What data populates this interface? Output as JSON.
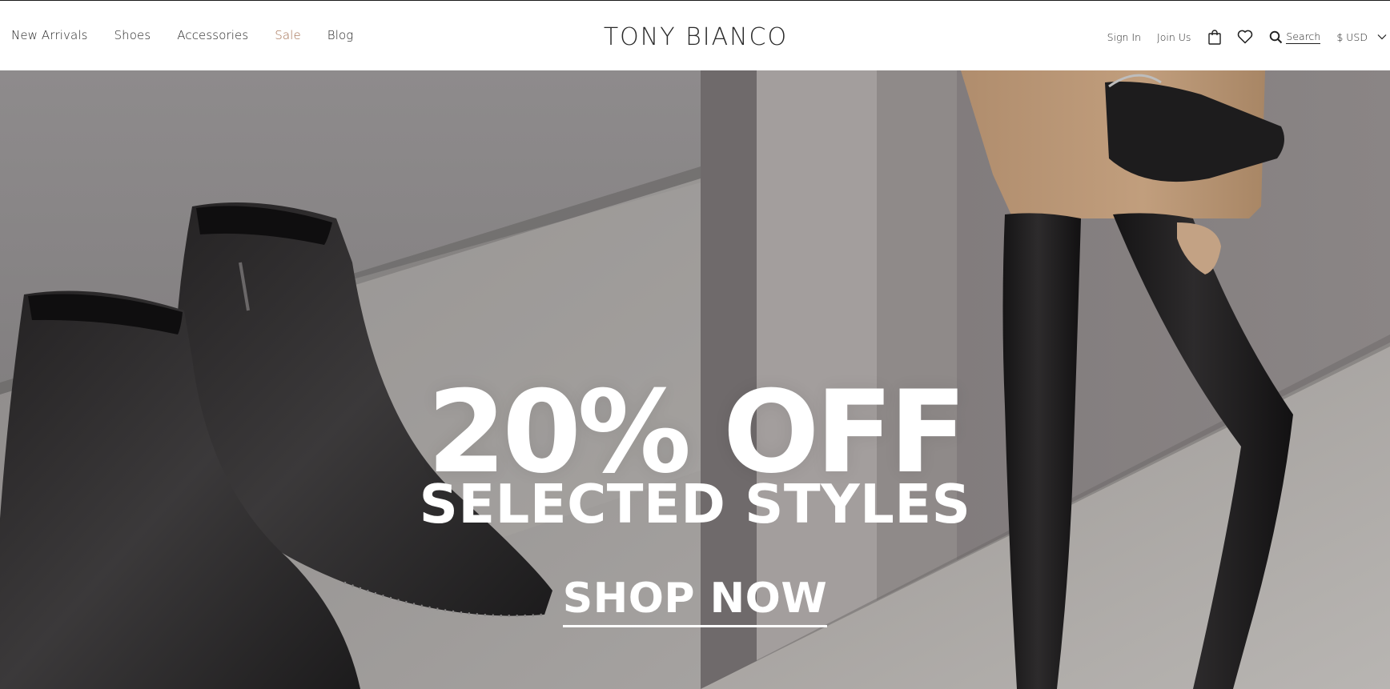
{
  "header": {
    "nav": {
      "new_arrivals": "New Arrivals",
      "shoes": "Shoes",
      "accessories": "Accessories",
      "sale": "Sale",
      "blog": "Blog"
    },
    "brand": "TONY BIANCO",
    "utility": {
      "sign_in": "Sign In",
      "join_us": "Join Us",
      "bag_icon": "shopping-bag-icon",
      "wishlist_icon": "heart-icon",
      "search_icon": "magnifier-icon",
      "search_label": "Search",
      "currency": "$ USD",
      "currency_icon": "chevron-down-icon"
    },
    "colors": {
      "sale": "#a06a4b",
      "text": "#1f1f1f"
    }
  },
  "hero": {
    "headline": "20% OFF",
    "subheadline": "SELECTED STYLES",
    "cta": "SHOP NOW"
  }
}
